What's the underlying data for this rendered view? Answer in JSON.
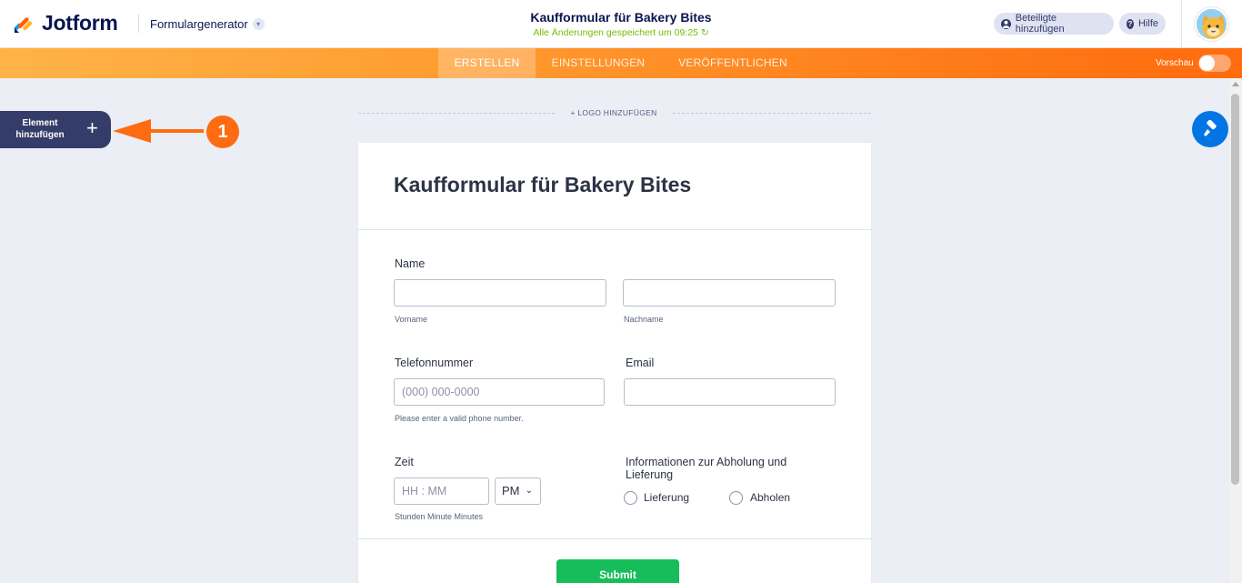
{
  "header": {
    "brand": "Jotform",
    "builder_select": "Formulargenerator",
    "form_title": "Kaufformular für Bakery Bites",
    "save_status": "Alle Änderungen gespeichert um 09:25",
    "invite_label": "Beteiligte hinzufügen",
    "help_label": "Hilfe"
  },
  "nav": {
    "tabs": [
      {
        "label": "ERSTELLEN",
        "active": true
      },
      {
        "label": "EINSTELLUNGEN",
        "active": false
      },
      {
        "label": "VERÖFFENTLICHEN",
        "active": false
      }
    ],
    "preview_label": "Vorschau",
    "preview_on": false
  },
  "sidebar": {
    "add_element_label": "Element hinzufügen"
  },
  "annotation": {
    "step": "1",
    "color": "#ff6b10"
  },
  "canvas": {
    "add_logo_label": "+ LOGO HINZUFÜGEN"
  },
  "form": {
    "title": "Kaufformular für Bakery Bites",
    "name": {
      "label": "Name",
      "first_sublabel": "Vorname",
      "last_sublabel": "Nachname"
    },
    "phone": {
      "label": "Telefonnummer",
      "placeholder": "(000) 000-0000",
      "sublabel": "Please enter a valid phone number."
    },
    "email": {
      "label": "Email"
    },
    "time": {
      "label": "Zeit",
      "placeholder": "HH : MM",
      "ampm": "PM",
      "sublabel": "Stunden Minute Minutes"
    },
    "pickup": {
      "label": "Informationen zur Abholung und Lieferung",
      "options": [
        "Lieferung",
        "Abholen"
      ]
    },
    "submit_label": "Submit"
  },
  "colors": {
    "brand_navy": "#0a1551",
    "nav_orange": "#ff7c1a",
    "submit_green": "#18bd5b",
    "designer_blue": "#0075e3",
    "status_green": "#78bb07"
  },
  "icons": [
    "jotform-logo-icon",
    "chevron-down-icon",
    "user-icon",
    "help-icon",
    "avatar-icon",
    "plus-icon",
    "arrow-left-icon",
    "paint-roller-icon"
  ]
}
